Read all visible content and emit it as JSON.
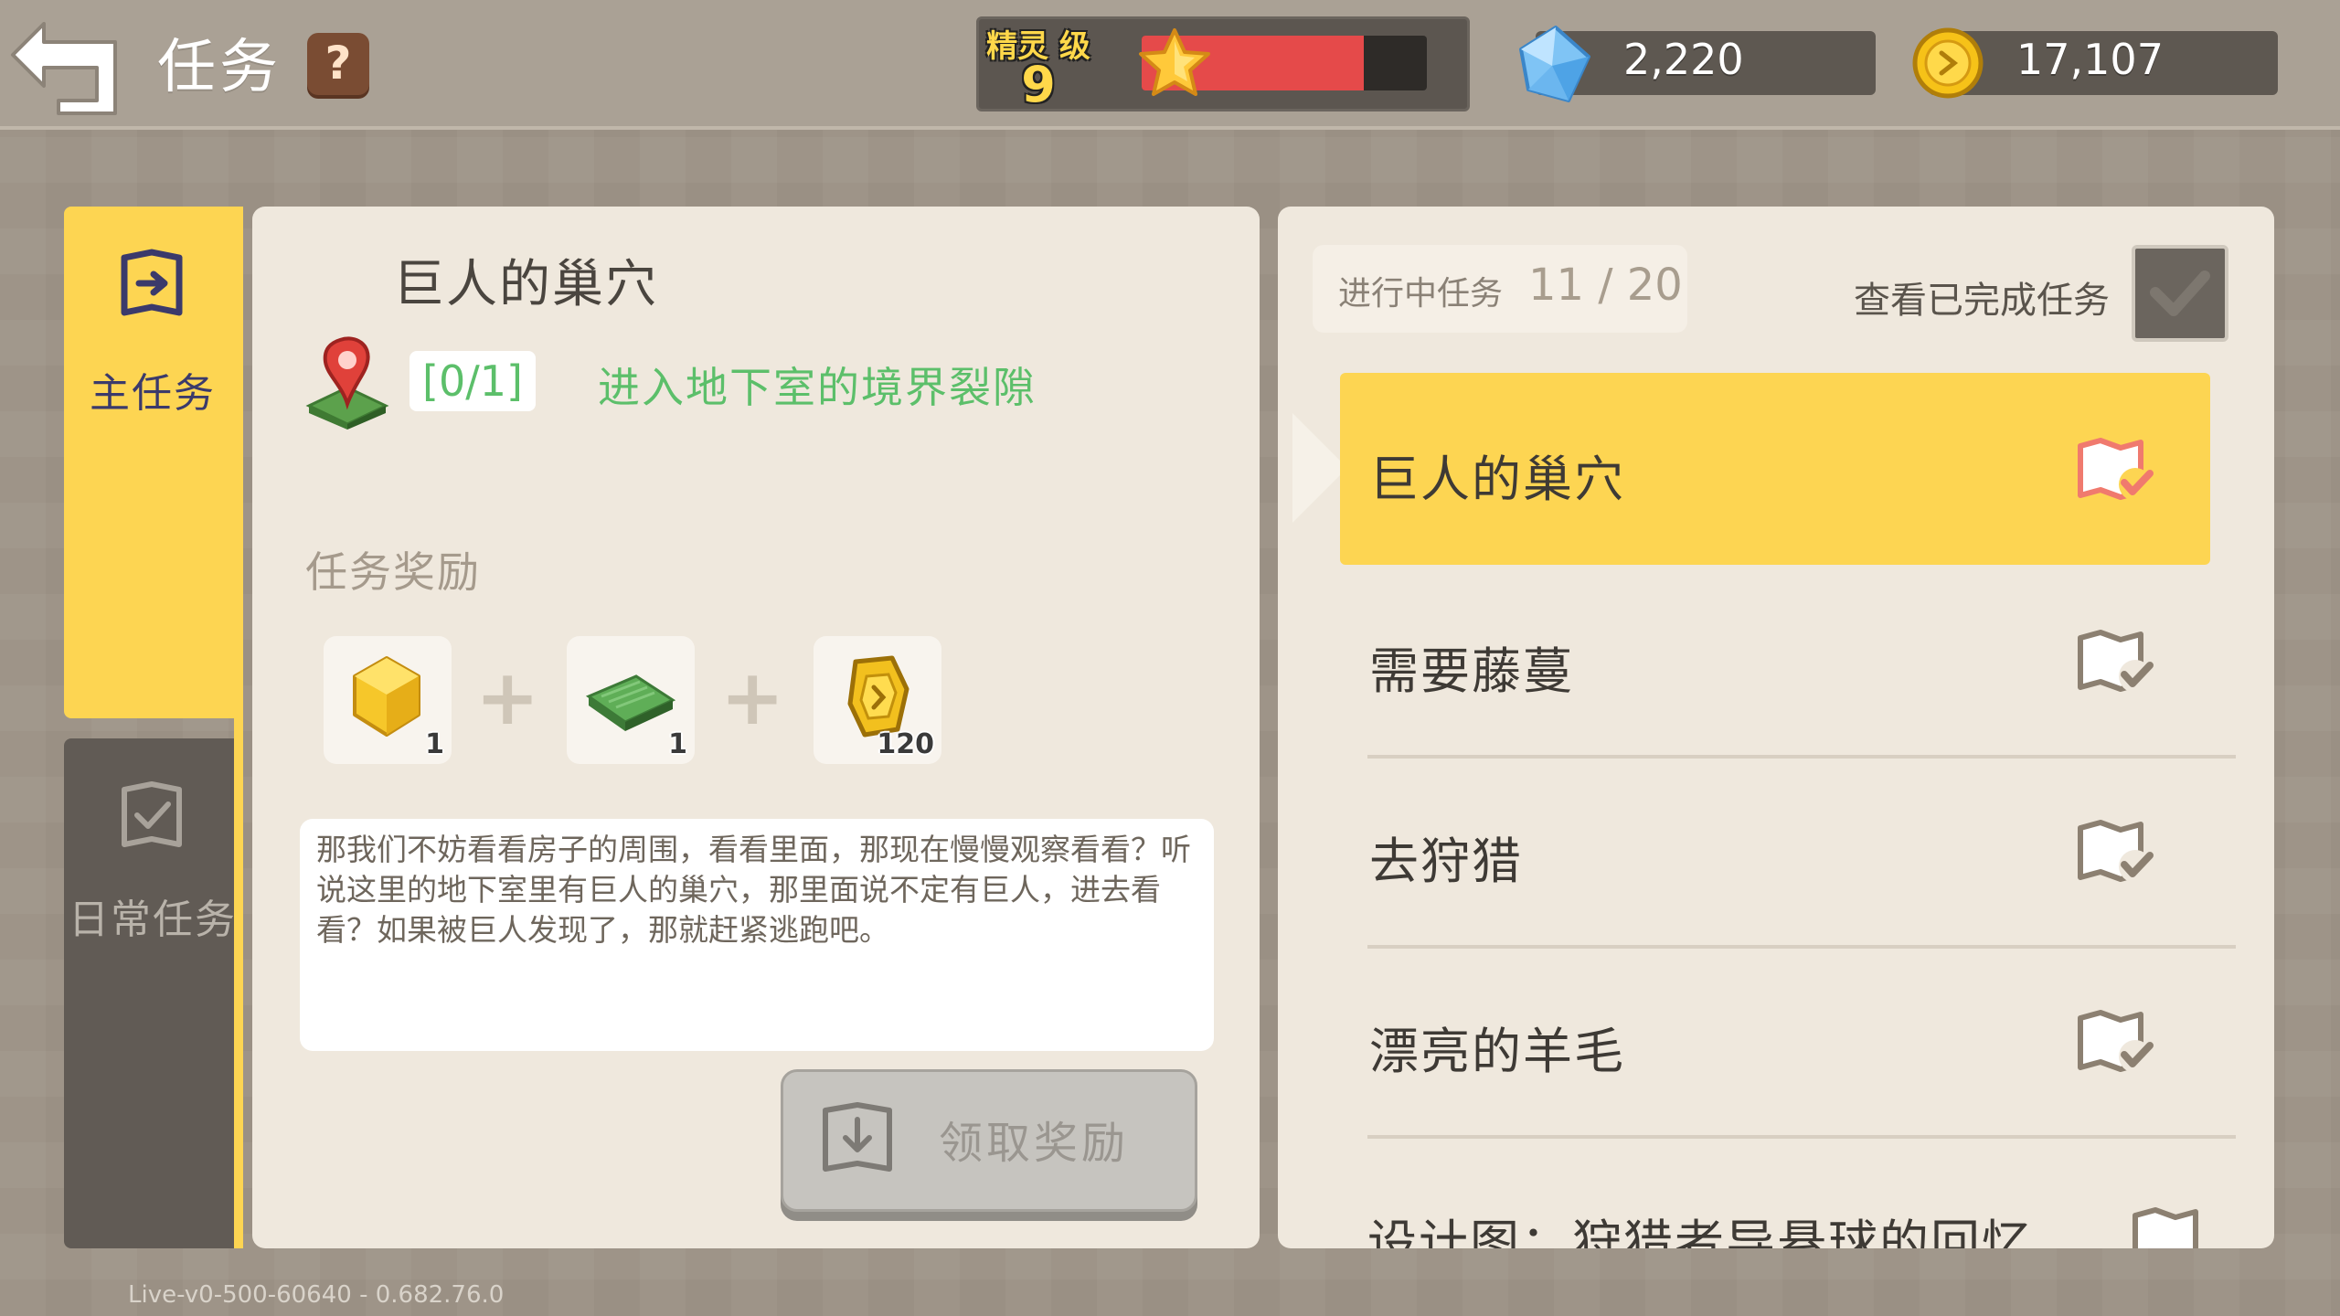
{
  "header": {
    "title": "任务",
    "help_label": "?",
    "level": {
      "label": "精灵 级",
      "value": "9",
      "xp_fraction": 0.78
    },
    "gems": "2,220",
    "coins": "17,107"
  },
  "tabs": {
    "main_label": "主任务",
    "daily_label": "日常任务"
  },
  "detail": {
    "quest_title": "巨人的巢穴",
    "objective_progress": "[0/1]",
    "objective_text": "进入地下室的境界裂隙",
    "reward_heading": "任务奖励",
    "rewards": [
      {
        "icon": "yellow-gem-icon",
        "count": "1"
      },
      {
        "icon": "grass-block-icon",
        "count": "1"
      },
      {
        "icon": "gold-coin-icon",
        "count": "120"
      }
    ],
    "description": "那我们不妨看看房子的周围，看看里面，那现在慢慢观察看看？听说这里的地下室里有巨人的巢穴，那里面说不定有巨人，进去看看？如果被巨人发现了，那就赶紧逃跑吧。",
    "claim_label": "领取奖励"
  },
  "list": {
    "in_progress_label": "进行中任务",
    "in_progress_count": "11 / 20",
    "view_completed_label": "查看已完成任务",
    "items": [
      {
        "name": "巨人的巢穴",
        "active": true
      },
      {
        "name": "需要藤蔓",
        "active": false
      },
      {
        "name": "去狩猎",
        "active": false
      },
      {
        "name": "漂亮的羊毛",
        "active": false
      },
      {
        "name": "设计图：狩猎者导悬球的回忆",
        "active": false
      }
    ]
  },
  "footer": {
    "version": "Live-v0-500-60640 - 0.682.76.0"
  },
  "colors": {
    "accent_yellow": "#fdd552",
    "objective_green": "#5cbf6a",
    "xp_red": "#e54a4a",
    "panel_bg": "#efe8dd"
  }
}
